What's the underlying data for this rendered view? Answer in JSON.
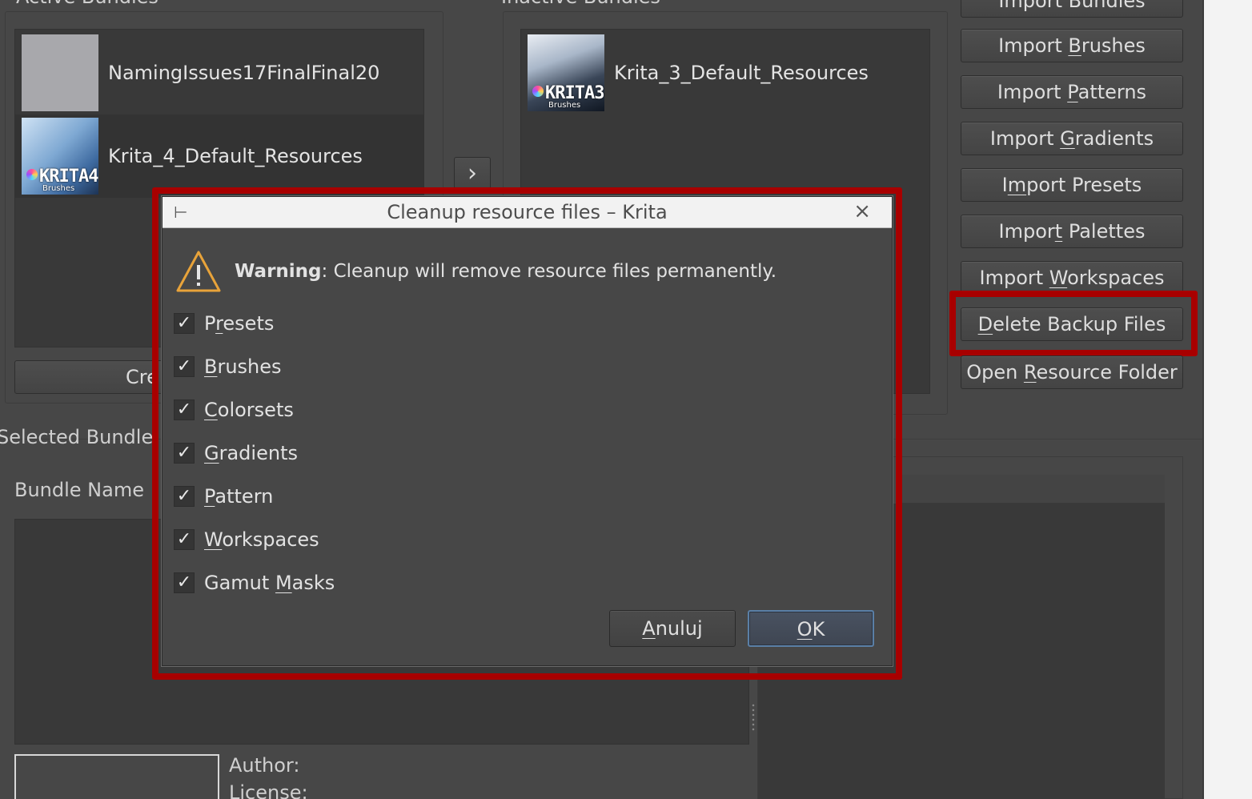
{
  "background": {
    "active_bundles_label": "Active Bundles",
    "inactive_bundles_label": "Inactive Bundles",
    "active_bundles": [
      {
        "name": "NamingIssues17FinalFinal20",
        "thumb": "grey-placeholder"
      },
      {
        "name": "Krita_4_Default_Resources",
        "thumb": "krita-4-artwork",
        "logo": "KRITA4",
        "logo_sub": "Brushes"
      }
    ],
    "inactive_bundles": [
      {
        "name": "Krita_3_Default_Resources",
        "thumb": "krita-3-artwork",
        "logo": "KRITA3",
        "logo_sub": "Brushes"
      }
    ],
    "move_arrow": "›",
    "create_button_partial": "Cre",
    "selected_bundle_label": "Selected Bundle",
    "bundle_name_label": "Bundle Name",
    "author_label": "Author:",
    "license_label": "License:",
    "side_buttons": [
      {
        "label": "Import Bundles",
        "u": "B",
        "pre": "Import ",
        "post": "undles"
      },
      {
        "label": "Import Brushes",
        "pre": "Import ",
        "u": "B",
        "post": "rushes"
      },
      {
        "label": "Import Patterns",
        "pre": "Import ",
        "u": "P",
        "post": "atterns"
      },
      {
        "label": "Import Gradients",
        "pre": "Import ",
        "u": "G",
        "post": "radients"
      },
      {
        "label": "Import Presets",
        "pre": "I",
        "u": "m",
        "post": "port Presets"
      },
      {
        "label": "Import Palettes",
        "pre": "Impor",
        "u": "t",
        "post": " Palettes"
      },
      {
        "label": "Import Workspaces",
        "pre": "Import ",
        "u": "W",
        "post": "orkspaces"
      },
      {
        "label": "Delete Backup Files",
        "pre": "",
        "u": "D",
        "post": "elete Backup Files"
      },
      {
        "label": "Open Resource Folder",
        "pre": "Open ",
        "u": "R",
        "post": "esource Folder"
      }
    ],
    "highlight_color": "#a80000"
  },
  "dialog": {
    "title": "Cleanup resource files – Krita",
    "pin_icon": "⊢",
    "close_icon": "×",
    "warning_bold": "Warning",
    "warning_text": ": Cleanup will remove resource files permanently.",
    "checkboxes": [
      {
        "label": "Presets",
        "pre": "P",
        "u": "r",
        "post": "esets",
        "checked": true
      },
      {
        "label": "Brushes",
        "pre": "",
        "u": "B",
        "post": "rushes",
        "checked": true
      },
      {
        "label": "Colorsets",
        "pre": "",
        "u": "C",
        "post": "olorsets",
        "checked": true
      },
      {
        "label": "Gradients",
        "pre": "",
        "u": "G",
        "post": "radients",
        "checked": true
      },
      {
        "label": "Pattern",
        "pre": "",
        "u": "P",
        "post": "attern",
        "checked": true
      },
      {
        "label": "Workspaces",
        "pre": "",
        "u": "W",
        "post": "orkspaces",
        "checked": true
      },
      {
        "label": "Gamut Masks",
        "pre": "Gamut ",
        "u": "M",
        "post": "asks",
        "checked": true
      }
    ],
    "check_mark": "✓",
    "cancel_button": {
      "pre": "",
      "u": "A",
      "post": "nuluj"
    },
    "ok_button": {
      "pre": "",
      "u": "O",
      "post": "K"
    }
  }
}
